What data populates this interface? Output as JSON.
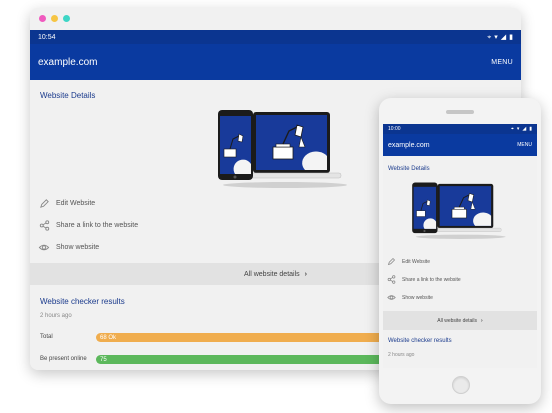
{
  "tablet": {
    "status_time": "10:54",
    "app_title": "example.com",
    "menu_label": "MENU",
    "details_title": "Website Details",
    "actions": [
      {
        "label": "Edit Website",
        "icon": "pencil-icon"
      },
      {
        "label": "Share a link to the website",
        "icon": "share-icon"
      },
      {
        "label": "Show website",
        "icon": "eye-icon"
      }
    ],
    "all_details_label": "All website details",
    "checker_title": "Website checker results",
    "checked_ago": "2 hours ago",
    "results": [
      {
        "label": "Total",
        "value_text": "68 Ok",
        "color": "#f0ad4e"
      },
      {
        "label": "Be present online",
        "value_text": "75",
        "color": "#5cb85c"
      }
    ]
  },
  "phone": {
    "status_time": "10:00",
    "app_title": "example.com",
    "menu_label": "MENU",
    "details_title": "Website Details",
    "actions": [
      {
        "label": "Edit Website",
        "icon": "pencil-icon"
      },
      {
        "label": "Share a link to the website",
        "icon": "share-icon"
      },
      {
        "label": "Show website",
        "icon": "eye-icon"
      }
    ],
    "all_details_label": "All website details",
    "checker_title": "Website checker results",
    "checked_ago": "2 hours ago"
  },
  "colors": {
    "primary": "#0a3aa0",
    "section_title": "#1a3a8c",
    "illustration_bg": "#183a9a"
  }
}
